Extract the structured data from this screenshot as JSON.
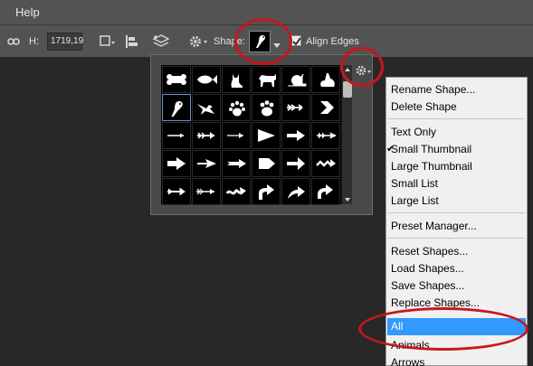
{
  "menubar": {
    "help_label": "Help"
  },
  "options": {
    "h_label": "H:",
    "h_value": "1719,19",
    "shape_label": "Shape:",
    "align_edges_label": "Align Edges",
    "align_edges_checked": true
  },
  "shape_picker": {
    "selected_cell": "parrot",
    "cells": [
      [
        "bone",
        "fish",
        "cat",
        "dog",
        "snail",
        "rabbit"
      ],
      [
        "parrot",
        "bird",
        "paw-print",
        "paw-print-2",
        "arrow-feather",
        "chevron-arrow"
      ],
      [
        "arrow-thin",
        "arrow-feather-2",
        "arrow-line",
        "arrowhead",
        "arrow-bold",
        "arrow-dart"
      ],
      [
        "arrow-block",
        "arrow-sleek",
        "arrow-fletched",
        "arrow-pentagon",
        "arrow-wide",
        "arrow-zigzag"
      ],
      [
        "arrow-double",
        "arrow-tail",
        "arrow-wavy",
        "arrow-curved-right",
        "arrow-curved-up",
        "arrow-curved-turn"
      ]
    ]
  },
  "menu": {
    "items": [
      "Rename Shape...",
      "Delete Shape",
      "Text Only",
      "Small Thumbnail",
      "Large Thumbnail",
      "Small List",
      "Large List",
      "Preset Manager...",
      "Reset Shapes...",
      "Load Shapes...",
      "Save Shapes...",
      "Replace Shapes...",
      "All",
      "Animals",
      "Arrows"
    ],
    "checked_item": "Small Thumbnail",
    "highlighted_item": "All"
  },
  "colors": {
    "annotation": "#c8161d",
    "highlight": "#3399ff"
  }
}
